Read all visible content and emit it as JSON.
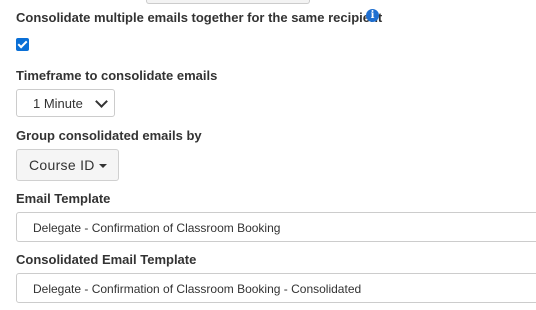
{
  "consolidate": {
    "label": "Consolidate multiple emails together for the same recipient",
    "info_icon": "info-circle-icon",
    "checked": true
  },
  "timeframe": {
    "label": "Timeframe to consolidate emails",
    "selected": "1 Minute"
  },
  "group_by": {
    "label": "Group consolidated emails by",
    "selected": "Course ID"
  },
  "email_template": {
    "label": "Email Template",
    "value": "Delegate - Confirmation of Classroom Booking"
  },
  "consolidated_template": {
    "label": "Consolidated Email Template",
    "value": "Delegate - Confirmation of Classroom Booking - Consolidated"
  },
  "colors": {
    "checkbox": "#0a6fd6",
    "info_icon": "#1f6fd0",
    "text": "#333333"
  }
}
